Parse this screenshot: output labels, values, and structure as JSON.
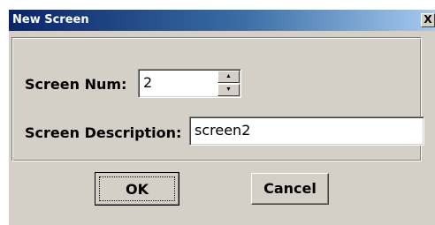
{
  "window": {
    "title": "New Screen",
    "close_glyph": "X"
  },
  "form": {
    "screen_num_label": "Screen Num:",
    "screen_num_value": "2",
    "screen_description_label": "Screen Description:",
    "screen_description_value": "screen2"
  },
  "spinner": {
    "up_glyph": "▲",
    "down_glyph": "▼"
  },
  "buttons": {
    "ok_label": "OK",
    "cancel_label": "Cancel"
  },
  "colors": {
    "dialog_bg": "#d4d0c8",
    "titlebar_start": "#0a246a",
    "titlebar_end": "#a6caf0"
  }
}
